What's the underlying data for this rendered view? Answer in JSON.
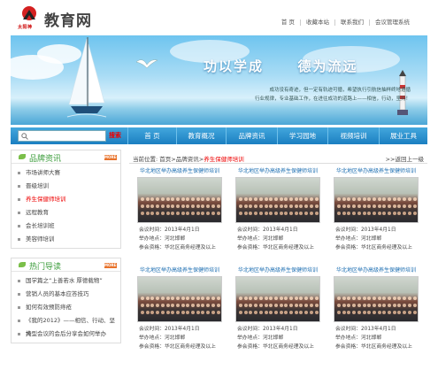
{
  "header": {
    "logo_sub": "太阳神",
    "site_name": "教育网",
    "links": [
      "首 页",
      "收藏本站",
      "联系我们",
      "会议管理系统"
    ]
  },
  "banner": {
    "slogan_left": "功以学成",
    "slogan_right": "德为流远",
    "motto_line1": "成功没有奇迹，但一定有轨迹可循，希望执行引航信抽样终地遵循",
    "motto_line2": "行业规律，专业基础工作，在进往成功的道路上——相信，行动，坚持！"
  },
  "nav": {
    "search_placeholder": "",
    "search_label": "搜索",
    "items": [
      "首 页",
      "教育概况",
      "品牌资讯",
      "学习园地",
      "视频培训",
      "展业工具"
    ]
  },
  "sidebar": {
    "brand_title": "品牌资讯",
    "brand_items": [
      "市场讲师大赛",
      "晋级培训",
      "养生保健师培训",
      "远程教育",
      "会长培训班",
      "美容师培训"
    ],
    "hot_title": "热门导读",
    "hot_items": [
      "国学篇之“上善若水 厚德载物”",
      "营销人员的基本应答技巧",
      "如何有效预防痔疮",
      "《我的2012》——相信、行动、坚持",
      "大型会议的会后分享会如何举办"
    ],
    "more": "MORE+"
  },
  "main": {
    "crumb_label": "当前位置:",
    "crumb_home": "首页",
    "crumb_section": "品牌资讯",
    "crumb_current": "养生保健师培训",
    "back": ">>返回上一级",
    "cards": [
      {
        "title": "华北地区举办高级养生保健师培训",
        "time": "会议时间：2013年4月1日",
        "place": "举办地点：河北邯郸",
        "detail": "参会资格：华北区商务经理及以上"
      },
      {
        "title": "华北地区举办高级养生保健师培训",
        "time": "会议时间：2013年4月1日",
        "place": "举办地点：河北邯郸",
        "detail": "参会资格：华北区商务经理及以上"
      },
      {
        "title": "华北地区举办高级养生保健师培训",
        "time": "会议时间：2013年4月1日",
        "place": "举办地点：河北邯郸",
        "detail": "参会资格：华北区商务经理及以上"
      },
      {
        "title": "华北地区举办高级养生保健师培训",
        "time": "会议时间：2013年4月1日",
        "place": "举办地点：河北邯郸",
        "detail": "参会资格：华北区商务经理及以上"
      },
      {
        "title": "华北地区举办高级养生保健师培训",
        "time": "会议时间：2013年4月1日",
        "place": "举办地点：河北邯郸",
        "detail": "参会资格：华北区商务经理及以上"
      },
      {
        "title": "华北地区举办高级养生保健师培训",
        "time": "会议时间：2013年4月1日",
        "place": "举办地点：河北邯郸",
        "detail": "参会资格：华北区商务经理及以上"
      }
    ]
  },
  "colors": {
    "accent": "#1b7fc1",
    "active": "#ee0000",
    "sidebar_title": "#3b9c3b",
    "more_tag": "#e8732c"
  }
}
